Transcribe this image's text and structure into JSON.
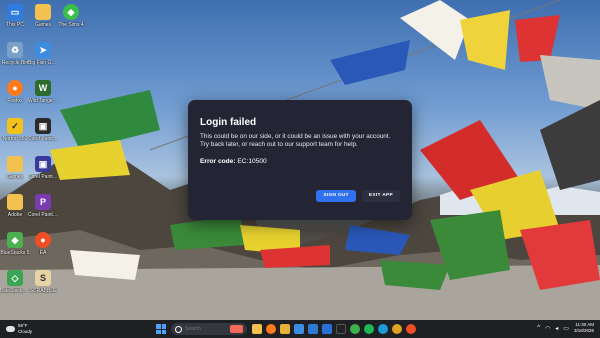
{
  "desktop": {
    "icons_col1": [
      {
        "label": "This PC",
        "icon": "computer-icon",
        "color": "#2f7ce0"
      },
      {
        "label": "Recycle Bin",
        "icon": "recycle-bin-icon",
        "color": "#7aa0c8"
      },
      {
        "label": "Firefox",
        "icon": "firefox-icon",
        "color": "#ff7a1a"
      },
      {
        "label": "Norton 360",
        "icon": "norton-icon",
        "color": "#f2c21a"
      },
      {
        "label": "Games",
        "icon": "folder-icon",
        "color": "#f2c14e"
      },
      {
        "label": "Adobe",
        "icon": "folder-icon",
        "color": "#f2c14e"
      },
      {
        "label": "BlueStacks 5",
        "icon": "bluestacks-icon",
        "color": "#4caf50"
      },
      {
        "label": "BlueStacks Multi-Insta...",
        "icon": "bluestacks-multi-icon",
        "color": "#3aa655"
      }
    ],
    "icons_col2": [
      {
        "label": "Games",
        "icon": "folder-icon",
        "color": "#f2c14e"
      },
      {
        "label": "Big Fish Games...",
        "icon": "bigfish-icon",
        "color": "#3c8de0"
      },
      {
        "label": "Wild Tangent Games",
        "icon": "wildtangent-icon",
        "color": "#2d6b2d"
      },
      {
        "label": "Corel Paint Shop Pro...",
        "icon": "paintshop-icon",
        "color": "#2a2a2a"
      },
      {
        "label": "Corel PaintSh...",
        "icon": "paintshop-icon",
        "color": "#3a3a9a"
      },
      {
        "label": "Corel Painter Essentials 7",
        "icon": "painter-icon",
        "color": "#7a3ab0"
      },
      {
        "label": "EA",
        "icon": "ea-icon",
        "color": "#f04e23"
      },
      {
        "label": "SCRABBLE",
        "icon": "scrabble-icon",
        "color": "#e8d3a6"
      }
    ],
    "icon_top": {
      "label": "The Sims 4",
      "icon": "sims-icon",
      "color": "#3bbf4a"
    }
  },
  "dialog": {
    "title": "Login failed",
    "message": "This could be on our side, or it could be an issue with your account. Try back later, or reach out to our support team for help.",
    "error_label": "Error code:",
    "error_code": "EC:10500",
    "sign_out_label": "SIGN OUT",
    "exit_app_label": "EXIT APP"
  },
  "taskbar": {
    "weather_temp": "56°F",
    "weather_desc": "Cloudy",
    "search_placeholder": "Search",
    "apps": [
      {
        "name": "file-explorer-icon",
        "color": "#f2c14e"
      },
      {
        "name": "firefox-icon",
        "color": "#ff7a1a"
      },
      {
        "name": "folder-icon",
        "color": "#e8b23a"
      },
      {
        "name": "photos-icon",
        "color": "#3a8de0"
      },
      {
        "name": "store-icon",
        "color": "#2d7ad6"
      },
      {
        "name": "mail-icon",
        "color": "#2a6fd6"
      },
      {
        "name": "game-icon",
        "color": "#222222"
      },
      {
        "name": "xbox-icon",
        "color": "#3bb34a"
      },
      {
        "name": "spotify-icon",
        "color": "#1db954"
      },
      {
        "name": "edge-icon",
        "color": "#1d9bd6"
      },
      {
        "name": "chrome-icon",
        "color": "#e0a020"
      },
      {
        "name": "ea-icon",
        "color": "#f04e23"
      }
    ],
    "time": "11:30 AM",
    "date": "3/18/2026"
  }
}
